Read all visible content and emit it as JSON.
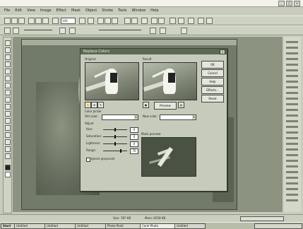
{
  "menu": [
    "File",
    "Edit",
    "View",
    "Image",
    "Effect",
    "Mask",
    "Object",
    "Stroke",
    "Tools",
    "Window",
    "Help"
  ],
  "toolbar": {
    "zoom_value": "100"
  },
  "dialog": {
    "title": "Replace Colors",
    "original_label": "Original",
    "result_label": "Result",
    "ok": "OK",
    "cancel": "Cancel",
    "help": "Help",
    "effects": "Effects...",
    "reset": "Reset",
    "preview": "Preview",
    "color_picker_label": "Color picker",
    "old_color_label": "Old color:",
    "new_color_label": "New color:",
    "adjust_label": "Adjust",
    "hue_label": "Hue:",
    "saturation_label": "Saturation:",
    "lightness_label": "Lightness:",
    "range_label": "Range:",
    "hue_value": "0",
    "saturation_value": "0",
    "lightness_value": "0",
    "range_value": "70",
    "ignore_label": "Ignore grayscale",
    "mask_label": "Mask preview"
  },
  "status": {
    "size": "Size: 787 KB",
    "mem": "Mem: 6558 KB"
  },
  "taskbar": [
    "Start",
    "Untitled",
    "Untitled",
    "Untitled",
    "Photo-Paint",
    "Corel Photo",
    "Untitled"
  ]
}
